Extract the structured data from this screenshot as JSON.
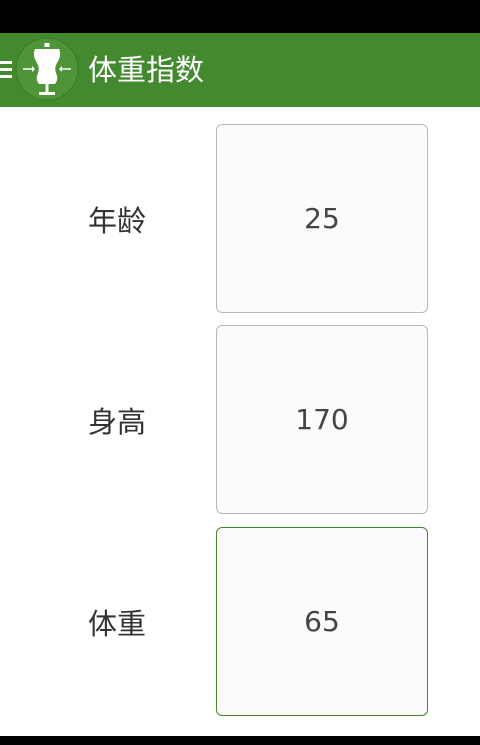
{
  "app_bar": {
    "title": "体重指数",
    "color": "#43892f"
  },
  "icons": {
    "menu": "hamburger-menu-icon",
    "logo": "dress-form-icon"
  },
  "form": {
    "rows": [
      {
        "label": "年龄",
        "value": "25"
      },
      {
        "label": "身高",
        "value": "170"
      },
      {
        "label": "体重",
        "value": "65"
      }
    ]
  }
}
